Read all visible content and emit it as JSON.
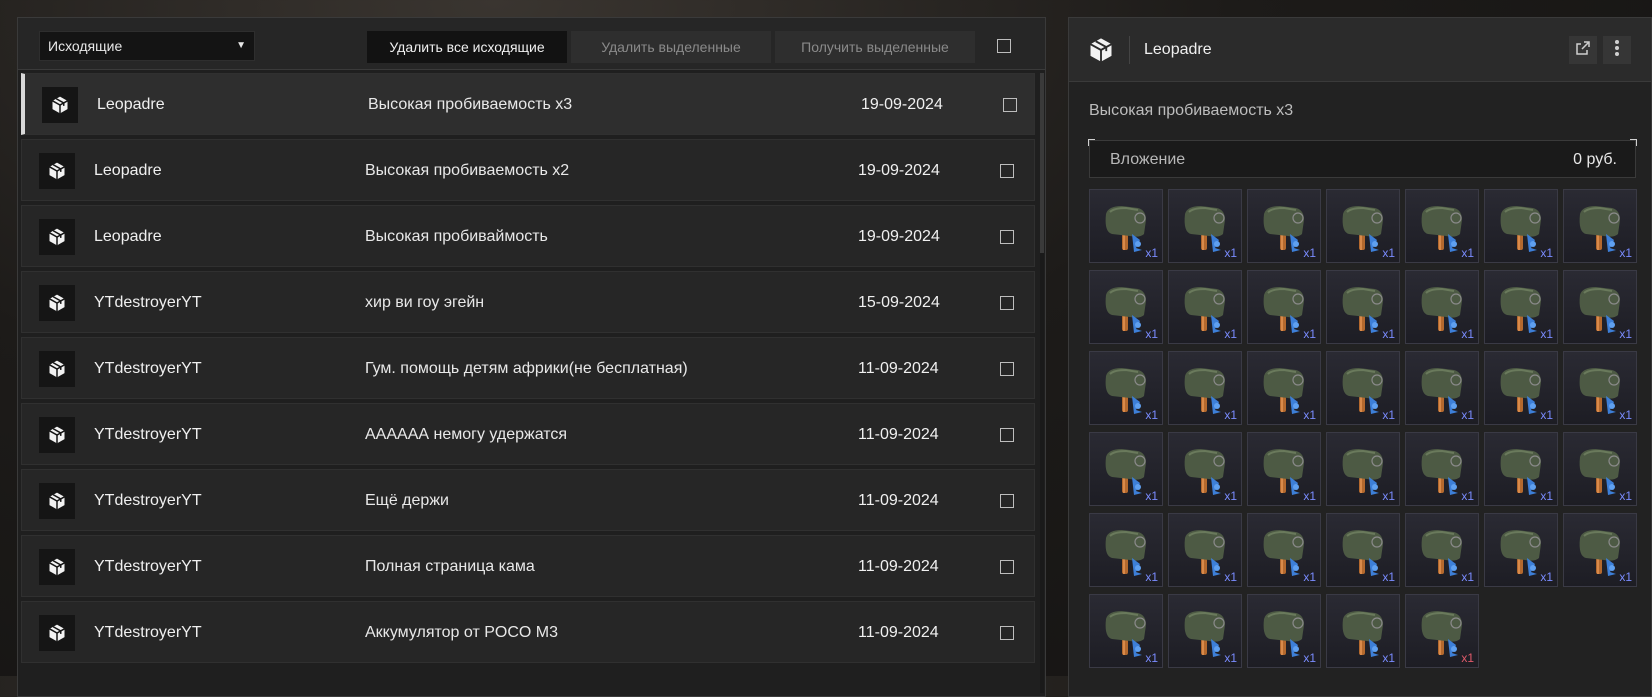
{
  "toolbar": {
    "filter_selected": "Исходящие",
    "delete_all_label": "Удалить все исходящие",
    "delete_selected_label": "Удалить выделенные",
    "get_selected_label": "Получить выделенные"
  },
  "messages": [
    {
      "sender": "Leopadre",
      "subject": "Высокая пробиваемость x3",
      "date": "19-09-2024",
      "selected": true
    },
    {
      "sender": "Leopadre",
      "subject": "Высокая пробиваемость x2",
      "date": "19-09-2024"
    },
    {
      "sender": "Leopadre",
      "subject": "Высокая пробиваймость",
      "date": "19-09-2024"
    },
    {
      "sender": "YTdestroyerYT",
      "subject": "хир ви гоу эгейн",
      "date": "15-09-2024"
    },
    {
      "sender": "YTdestroyerYT",
      "subject": "Гум. помощь детям африки(не бесплатная)",
      "date": "11-09-2024"
    },
    {
      "sender": "YTdestroyerYT",
      "subject": "АААААА немогу удержатся",
      "date": "11-09-2024"
    },
    {
      "sender": "YTdestroyerYT",
      "subject": "Ещё держи",
      "date": "11-09-2024"
    },
    {
      "sender": "YTdestroyerYT",
      "subject": "Полная страница кама",
      "date": "11-09-2024"
    },
    {
      "sender": "YTdestroyerYT",
      "subject": "Аккумулятор от POCO M3",
      "date": "11-09-2024"
    }
  ],
  "detail": {
    "sender": "Leopadre",
    "subject": "Высокая пробиваемость x3",
    "attachment_label": "Вложение",
    "attachment_value": "0 руб.",
    "item_icon": "grenade-launcher-item-icon",
    "items": [
      "x1",
      "x1",
      "x1",
      "x1",
      "x1",
      "x1",
      "x1",
      "x1",
      "x1",
      "x1",
      "x1",
      "x1",
      "x1",
      "x1",
      "x1",
      "x1",
      "x1",
      "x1",
      "x1",
      "x1",
      "x1",
      "x1",
      "x1",
      "x1",
      "x1",
      "x1",
      "x1",
      "x1",
      "x1",
      "x1",
      "x1",
      "x1",
      "x1",
      "x1",
      "x1",
      "x1",
      "x1",
      "x1",
      "x1",
      "x1"
    ],
    "last_item_variant": "red"
  },
  "colors": {
    "qty_default": "#7a8cff",
    "qty_alt": "#e05a6a"
  }
}
